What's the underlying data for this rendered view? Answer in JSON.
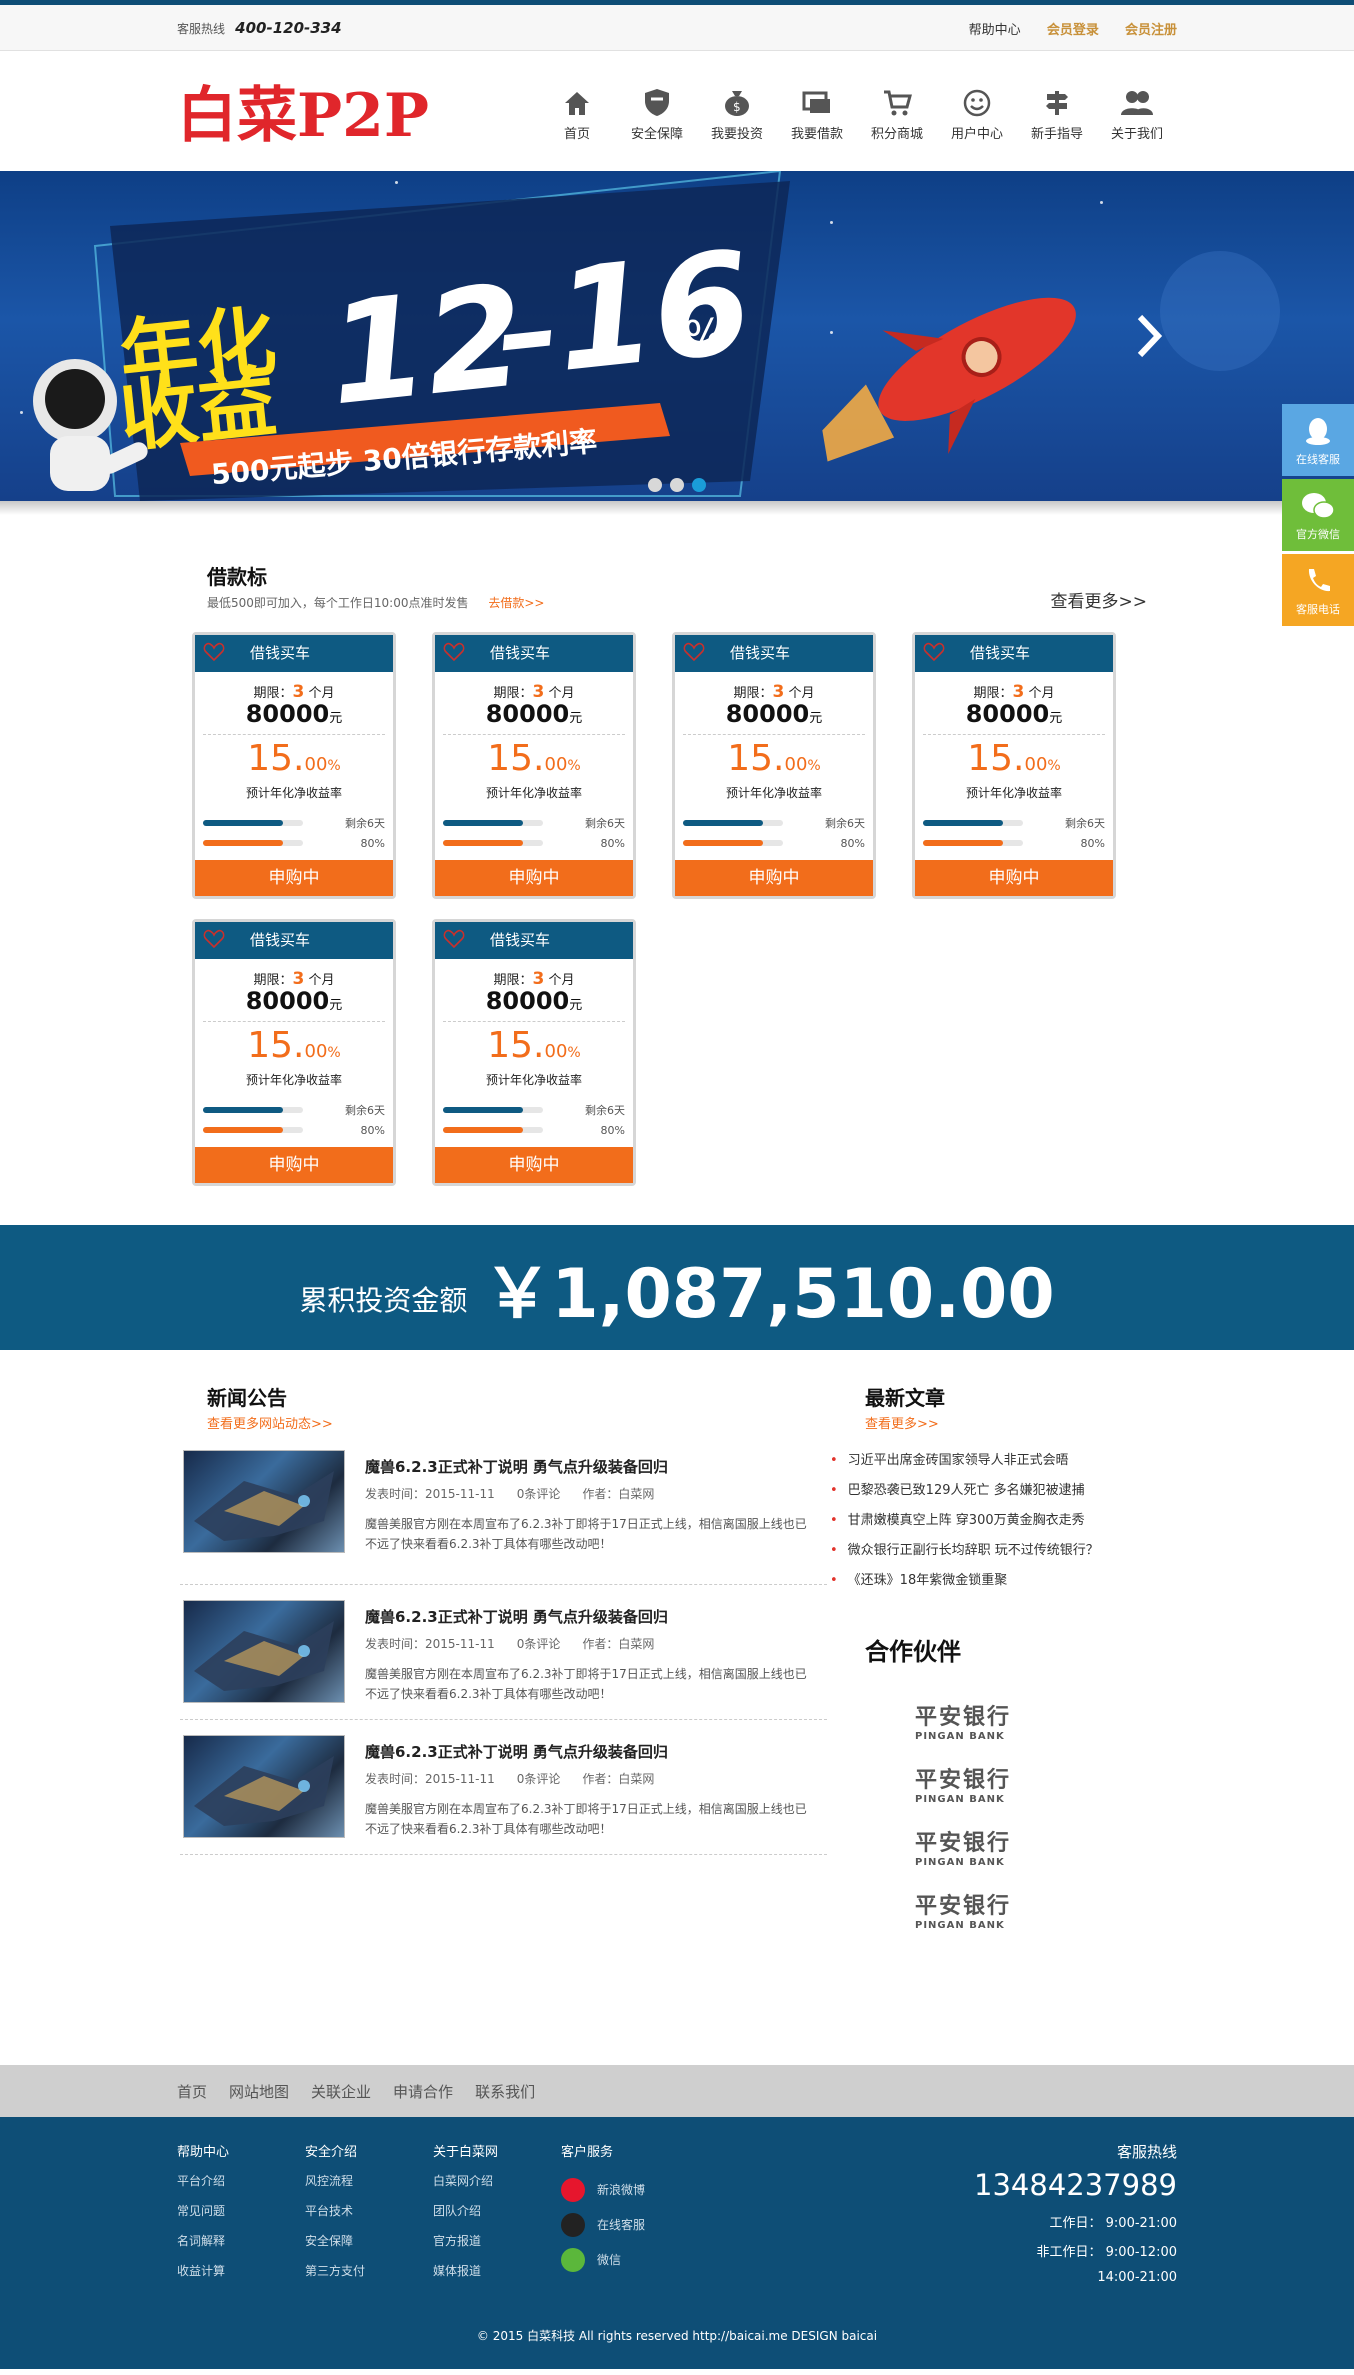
{
  "topbar": {
    "hotline_label": "客服热线",
    "hotline_number": "400-120-334",
    "help": "帮助中心",
    "login": "会员登录",
    "register": "会员注册"
  },
  "header": {
    "logo_text": "白菜P2P",
    "nav": [
      {
        "label": "首页",
        "icon": "home-icon"
      },
      {
        "label": "安全保障",
        "icon": "shield-icon"
      },
      {
        "label": "我要投资",
        "icon": "money-bag-icon"
      },
      {
        "label": "我要借款",
        "icon": "cards-icon"
      },
      {
        "label": "积分商城",
        "icon": "cart-icon"
      },
      {
        "label": "用户中心",
        "icon": "smiley-icon"
      },
      {
        "label": "新手指导",
        "icon": "signpost-icon"
      },
      {
        "label": "关于我们",
        "icon": "users-icon"
      }
    ]
  },
  "banner": {
    "tag1": "年化",
    "tag2": "收益",
    "rate_from": "12",
    "rate_to": "16",
    "percent": "%",
    "slogan": "500元起步  30倍银行存款利率",
    "active_dot": 3,
    "dot_count": 3,
    "next_icon": "chevron-right-icon"
  },
  "side": {
    "qq": "在线客服",
    "wechat": "官方微信",
    "phone": "客服电话"
  },
  "loans": {
    "title": "借款标",
    "subtitle": "最低500即可加入，每个工作日10:00点准时发售",
    "go_link": "去借款>>",
    "more": "查看更多>>",
    "cards": [
      {
        "name": "借钱买车",
        "term_label": "期限：",
        "term_value": "3",
        "term_unit": " 个月",
        "amount": "80000",
        "amount_unit": "元",
        "rate_int": "15.",
        "rate_dec": "00",
        "rate_pct": "%",
        "rate_label": "预计年化净收益率",
        "remaining": "剩余6天",
        "progress_label": "80%",
        "progress": 0.8,
        "button": "申购中"
      },
      {
        "name": "借钱买车",
        "term_label": "期限：",
        "term_value": "3",
        "term_unit": " 个月",
        "amount": "80000",
        "amount_unit": "元",
        "rate_int": "15.",
        "rate_dec": "00",
        "rate_pct": "%",
        "rate_label": "预计年化净收益率",
        "remaining": "剩余6天",
        "progress_label": "80%",
        "progress": 0.8,
        "button": "申购中"
      },
      {
        "name": "借钱买车",
        "term_label": "期限：",
        "term_value": "3",
        "term_unit": " 个月",
        "amount": "80000",
        "amount_unit": "元",
        "rate_int": "15.",
        "rate_dec": "00",
        "rate_pct": "%",
        "rate_label": "预计年化净收益率",
        "remaining": "剩余6天",
        "progress_label": "80%",
        "progress": 0.8,
        "button": "申购中"
      },
      {
        "name": "借钱买车",
        "term_label": "期限：",
        "term_value": "3",
        "term_unit": " 个月",
        "amount": "80000",
        "amount_unit": "元",
        "rate_int": "15.",
        "rate_dec": "00",
        "rate_pct": "%",
        "rate_label": "预计年化净收益率",
        "remaining": "剩余6天",
        "progress_label": "80%",
        "progress": 0.8,
        "button": "申购中"
      },
      {
        "name": "借钱买车",
        "term_label": "期限：",
        "term_value": "3",
        "term_unit": " 个月",
        "amount": "80000",
        "amount_unit": "元",
        "rate_int": "15.",
        "rate_dec": "00",
        "rate_pct": "%",
        "rate_label": "预计年化净收益率",
        "remaining": "剩余6天",
        "progress_label": "80%",
        "progress": 0.8,
        "button": "申购中"
      },
      {
        "name": "借钱买车",
        "term_label": "期限：",
        "term_value": "3",
        "term_unit": " 个月",
        "amount": "80000",
        "amount_unit": "元",
        "rate_int": "15.",
        "rate_dec": "00",
        "rate_pct": "%",
        "rate_label": "预计年化净收益率",
        "remaining": "剩余6天",
        "progress_label": "80%",
        "progress": 0.8,
        "button": "申购中"
      }
    ]
  },
  "total": {
    "label": "累积投资金额",
    "value": "￥1,087,510.00"
  },
  "news": {
    "title": "新闻公告",
    "more": "查看更多网站动态>>",
    "items": [
      {
        "title": "魔兽6.2.3正式补丁说明 勇气点升级装备回归",
        "date": "发表时间：2015-11-11",
        "comments": "0条评论",
        "author": "作者：白菜网",
        "desc": "魔兽美服官方刚在本周宣布了6.2.3补丁即将于17日正式上线，相信离国服上线也已不远了快来看看6.2.3补丁具体有哪些改动吧！"
      },
      {
        "title": "魔兽6.2.3正式补丁说明 勇气点升级装备回归",
        "date": "发表时间：2015-11-11",
        "comments": "0条评论",
        "author": "作者：白菜网",
        "desc": "魔兽美服官方刚在本周宣布了6.2.3补丁即将于17日正式上线，相信离国服上线也已不远了快来看看6.2.3补丁具体有哪些改动吧！"
      },
      {
        "title": "魔兽6.2.3正式补丁说明 勇气点升级装备回归",
        "date": "发表时间：2015-11-11",
        "comments": "0条评论",
        "author": "作者：白菜网",
        "desc": "魔兽美服官方刚在本周宣布了6.2.3补丁即将于17日正式上线，相信离国服上线也已不远了快来看看6.2.3补丁具体有哪些改动吧！"
      }
    ]
  },
  "articles": {
    "title": "最新文章",
    "more": "查看更多>>",
    "items": [
      "习近平出席金砖国家领导人非正式会晤",
      "巴黎恐袭已致129人死亡 多名嫌犯被逮捕",
      "甘肃嫩模真空上阵 穿300万黄金胸衣走秀",
      "微众银行正副行长均辞职 玩不过传统银行？",
      "《还珠》18年紫微金锁重聚"
    ]
  },
  "partners": {
    "title": "合作伙伴",
    "banks": [
      {
        "cn": "平安银行",
        "en": "PINGAN BANK"
      },
      {
        "cn": "平安银行",
        "en": "PINGAN BANK"
      },
      {
        "cn": "平安银行",
        "en": "PINGAN BANK"
      },
      {
        "cn": "平安银行",
        "en": "PINGAN BANK"
      }
    ]
  },
  "footer_nav": [
    "首页",
    "网站地图",
    "关联企业",
    "申请合作",
    "联系我们"
  ],
  "footer": {
    "cols": [
      {
        "title": "帮助中心",
        "items": [
          "平台介绍",
          "常见问题",
          "名词解释",
          "收益计算"
        ]
      },
      {
        "title": "安全介绍",
        "items": [
          "风控流程",
          "平台技术",
          "安全保障",
          "第三方支付"
        ]
      },
      {
        "title": "关于白菜网",
        "items": [
          "白菜网介绍",
          "团队介绍",
          "官方报道",
          "媒体报道"
        ]
      }
    ],
    "service": {
      "title": "客户服务",
      "items": [
        {
          "label": "新浪微博",
          "icon": "weibo-icon",
          "color": "#e6162d"
        },
        {
          "label": "在线客服",
          "icon": "qq-icon",
          "color": "#222222"
        },
        {
          "label": "微信",
          "icon": "wechat-icon",
          "color": "#5bb73b"
        }
      ]
    },
    "hotline_title": "客服热线",
    "hotline": "13484237989",
    "workday": "工作日： 9:00-21:00",
    "nonworkday": "非工作日： 9:00-12:00",
    "afternoon": "14:00-21:00",
    "copyright": "© 2015 白菜科技 All rights reserved http://baicai.me DESIGN baicai"
  },
  "colors": {
    "primary": "#0e5a82",
    "accent": "#f26d1b",
    "gold": "#c8913a"
  }
}
